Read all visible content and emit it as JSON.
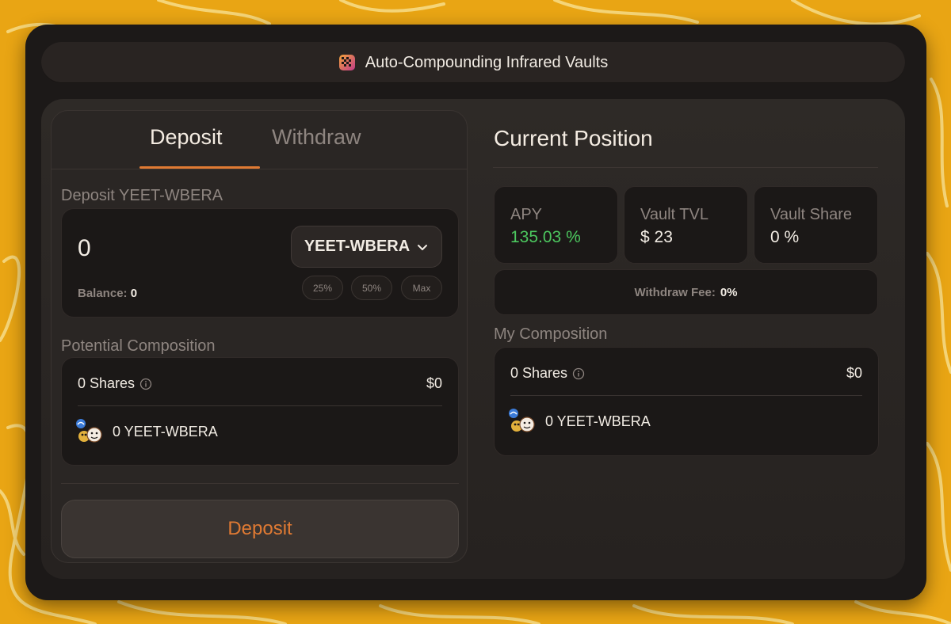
{
  "window": {
    "title": "Auto-Compounding Infrared Vaults"
  },
  "tabs": [
    {
      "label": "Deposit",
      "active": true
    },
    {
      "label": "Withdraw",
      "active": false
    }
  ],
  "deposit": {
    "section_label": "Deposit YEET-WBERA",
    "amount_value": "0",
    "token_selected": "YEET-WBERA",
    "balance_label": "Balance:",
    "balance_value": "0",
    "quick_amounts": [
      "25%",
      "50%",
      "Max"
    ],
    "button_label": "Deposit"
  },
  "potential_composition": {
    "label": "Potential Composition",
    "shares_label": "0 Shares",
    "shares_value": "$0",
    "token_line": "0 YEET-WBERA"
  },
  "current_position": {
    "title": "Current Position",
    "stats": [
      {
        "label": "APY",
        "value": "135.03 %",
        "color": "#4cc85f"
      },
      {
        "label": "Vault TVL",
        "value": "$ 23"
      },
      {
        "label": "Vault Share",
        "value": "0 %"
      }
    ],
    "withdraw_fee_label": "Withdraw Fee:",
    "withdraw_fee_value": "0%"
  },
  "my_composition": {
    "label": "My Composition",
    "shares_label": "0 Shares",
    "shares_value": "$0",
    "token_line": "0 YEET-WBERA"
  },
  "colors": {
    "background": "#e9a514",
    "window": "#1c1918",
    "accent": "#e07a33",
    "positive": "#4cc85f"
  },
  "icons": {
    "title": "infrared-logo-icon",
    "select": "chevron-down-icon",
    "info": "info-icon",
    "token": "yeet-wbera-pair-icon"
  }
}
